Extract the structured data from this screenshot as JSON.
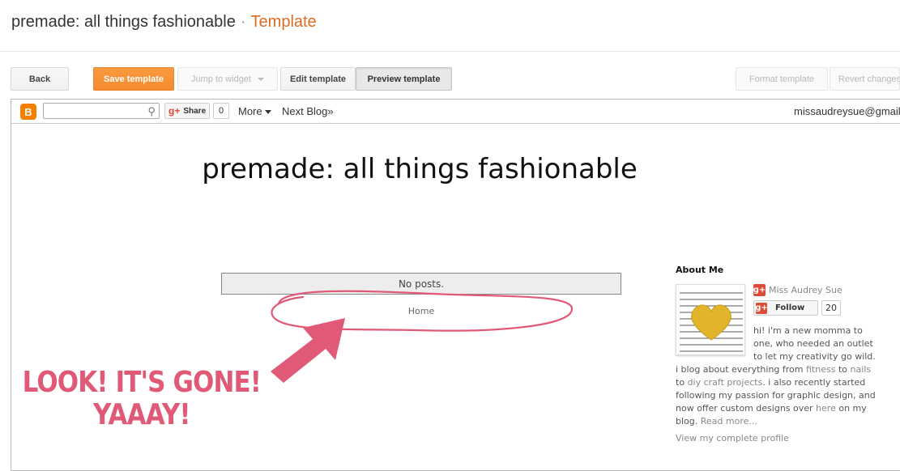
{
  "header": {
    "blog_name": "premade: all things fashionable",
    "separator": "·",
    "section": "Template"
  },
  "toolbar": {
    "back": "Back",
    "save": "Save template",
    "jump": "Jump to widget",
    "edit": "Edit template",
    "preview": "Preview template",
    "format": "Format template",
    "revert": "Revert changes"
  },
  "navbar": {
    "share_label": "Share",
    "share_count": "0",
    "more": "More",
    "next_blog": "Next Blog»",
    "email": "missaudreysue@gmail.com"
  },
  "blog": {
    "title": "premade: all things fashionable",
    "no_posts": "No posts.",
    "home": "Home"
  },
  "annotation": {
    "line1": "LOOK! IT'S GONE!",
    "line2": "YAAAY!",
    "color": "#e05a78"
  },
  "sidebar": {
    "heading": "About Me",
    "name": "Miss Audrey Sue",
    "follow": "Follow",
    "follow_count": "20",
    "bio_line1": "hi! i'm a new momma to",
    "bio_line2": "one, who needed an outlet",
    "bio_line3": "to let my creativity go wild.",
    "bio_line4_pre": "i blog about everything from ",
    "bio_fitness": "fitness",
    "bio_to": " to ",
    "bio_nails": "nails",
    "bio_line5_pre": "to ",
    "bio_diy": "diy craft projects",
    "bio_line5_post": ". i also recently started",
    "bio_line6": "following my passion for graphic design, and",
    "bio_line7_pre": "now offer custom designs over ",
    "bio_here": "here",
    "bio_line7_post": " on my",
    "bio_line8_pre": "blog. ",
    "bio_read_more": "Read more...",
    "view_profile": "View my complete profile"
  },
  "colors": {
    "accent_orange": "#dd6b22",
    "save_button": "#f48a2e",
    "annotation_pink": "#e05a78",
    "gplus_red": "#dd4b39"
  }
}
